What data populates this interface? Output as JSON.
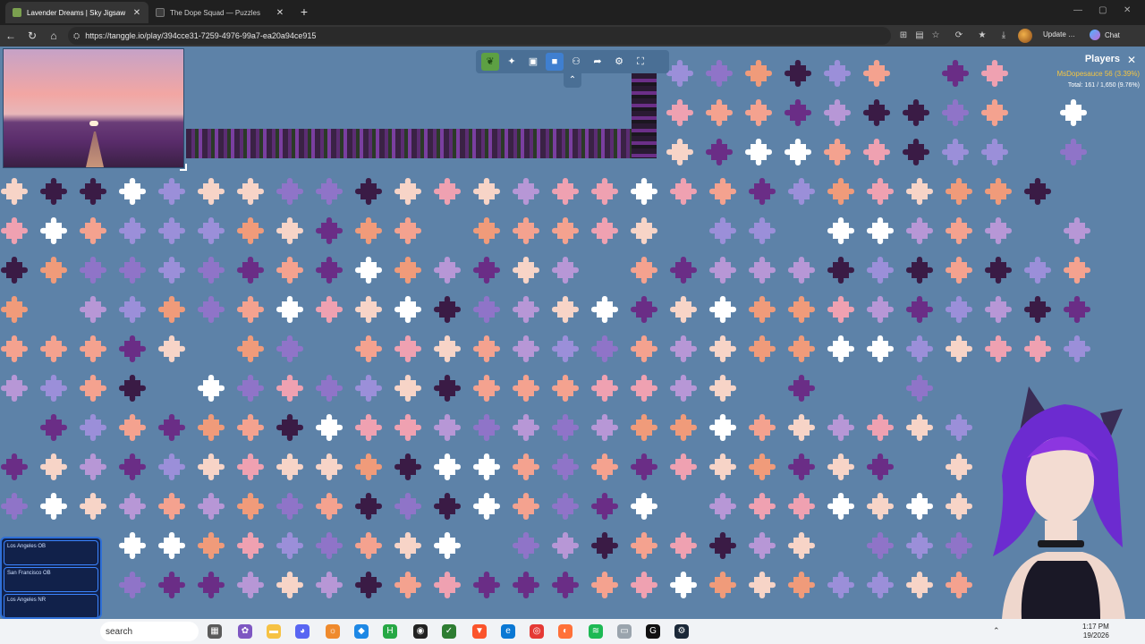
{
  "browser": {
    "tabs": [
      {
        "label": "Lavender Dreams | Sky Jigsaw",
        "active": true
      },
      {
        "label": "The Dope Squad — Puzzles",
        "active": false
      }
    ],
    "url": "https://tanggle.io/play/394cce31-7259-4976-99a7-ea20a94ce915",
    "update_label": "Update",
    "chat_label": "Chat"
  },
  "game": {
    "players": {
      "title": "Players",
      "player_name": "MsDopesauce",
      "player_stat": "56 (3.39%)",
      "total": "Total: 161 / 1,650 (9.76%)"
    },
    "toolbar": {
      "icons": [
        "leaf-icon",
        "puzzle-piece-icon",
        "image-preview-icon",
        "background-color-icon",
        "players-icon",
        "share-icon",
        "settings-icon",
        "fullscreen-icon"
      ]
    },
    "widget": {
      "rows": [
        "Los Angeles OB",
        "San Francisco OB",
        "Los Angeles NR"
      ]
    }
  },
  "taskbar": {
    "search_label": "search",
    "time": "1:17 PM",
    "date": "19/2026"
  },
  "colors": {
    "board": "#5d82a8",
    "pieces": [
      "#f4a28f",
      "#f7d4c7",
      "#efa1b1",
      "#b797d6",
      "#9b8fd9",
      "#3a1b45",
      "#6a2d86",
      "#ffffff",
      "#f09b7a",
      "#8f74c8"
    ]
  }
}
